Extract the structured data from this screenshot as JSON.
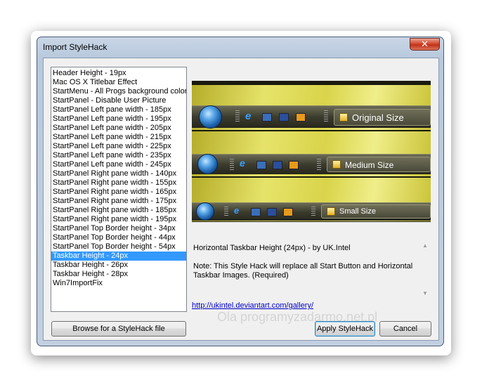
{
  "window": {
    "title": "Import StyleHack",
    "close_glyph": "✕"
  },
  "list": {
    "items": [
      "Header Height - 19px",
      "Mac OS X Titlebar Effect",
      "StartMenu - All Progs background color",
      "StartPanel - Disable User Picture",
      "StartPanel Left pane width - 185px",
      "StartPanel Left pane width - 195px",
      "StartPanel Left pane width - 205px",
      "StartPanel Left pane width - 215px",
      "StartPanel Left pane width - 225px",
      "StartPanel Left pane width - 235px",
      "StartPanel Left pane width - 245px",
      "StartPanel Right pane width - 140px",
      "StartPanel Right pane width - 155px",
      "StartPanel Right pane width - 165px",
      "StartPanel Right pane width - 175px",
      "StartPanel Right pane width - 185px",
      "StartPanel Right pane width - 195px",
      "StartPanel Top Border height - 34px",
      "StartPanel Top Border height - 44px",
      "StartPanel Top Border height - 54px",
      "Taskbar Height - 24px",
      "Taskbar Height - 26px",
      "Taskbar Height - 28px",
      "Win7ImportFix"
    ],
    "selected_index": 20
  },
  "preview": {
    "original_label": "Original Size",
    "medium_label": "Medium Size",
    "small_label": "Small Size",
    "ie_glyph": "e"
  },
  "description": {
    "title_line": "Horizontal Taskbar Height (24px) - by UK.Intel",
    "note": "Note: This Style Hack will replace all Start Button and Horizontal Taskbar Images. (Required)"
  },
  "link": "http://ukintel.deviantart.com/gallery/",
  "watermark": "Ola programyzadarmo.net.pl",
  "buttons": {
    "browse": "Browse for a StyleHack file",
    "apply": "Apply StyleHack",
    "cancel": "Cancel"
  },
  "scrollbar": {
    "up": "▲",
    "down": "▼"
  }
}
